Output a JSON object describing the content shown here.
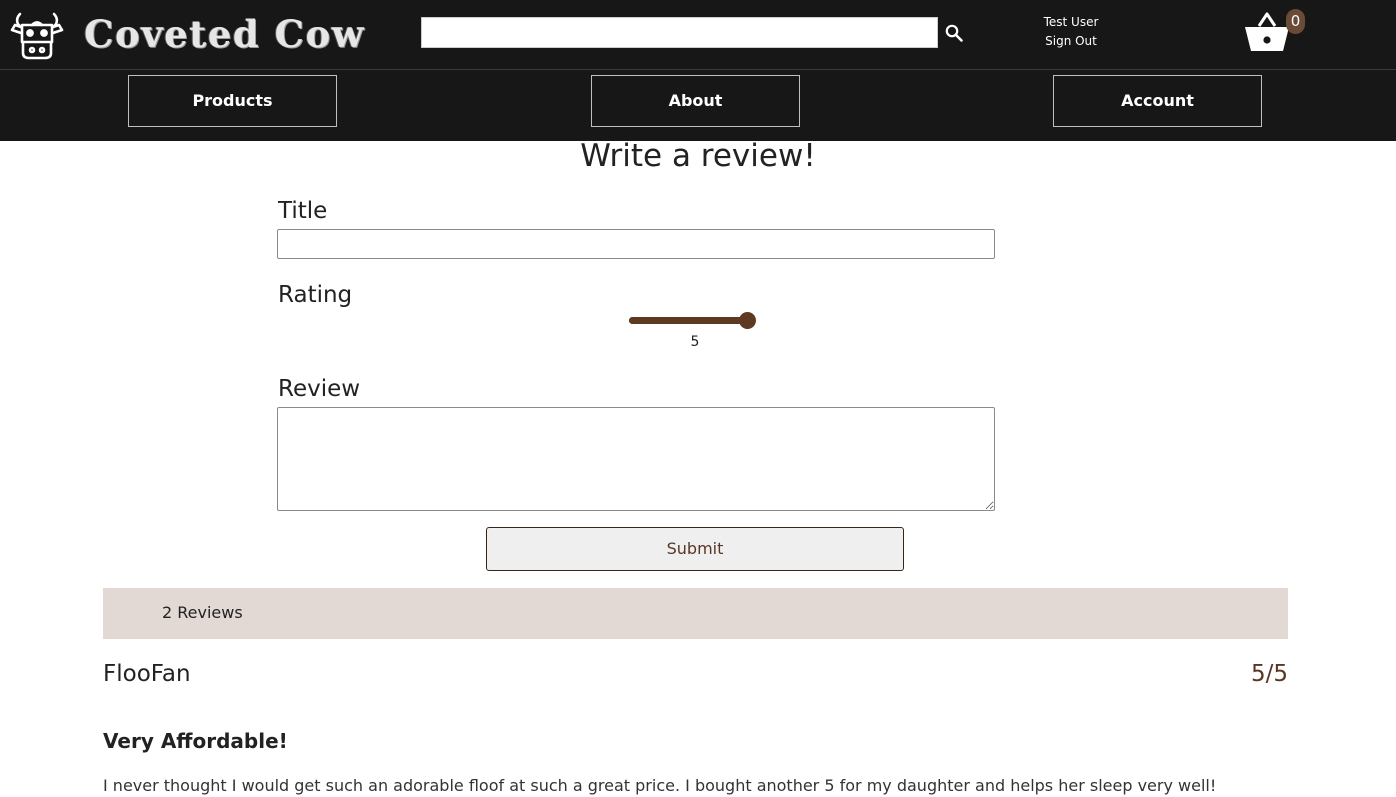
{
  "header": {
    "brand": "Coveted Cow",
    "search": {
      "value": "",
      "placeholder": ""
    },
    "user": {
      "name": "Test User",
      "signout_label": "Sign Out"
    },
    "cart": {
      "count": "0"
    }
  },
  "nav": {
    "items": [
      {
        "label": "Products"
      },
      {
        "label": "About"
      },
      {
        "label": "Account"
      }
    ]
  },
  "review_form": {
    "heading": "Write a review!",
    "title_label": "Title",
    "title_value": "",
    "rating_label": "Rating",
    "rating": {
      "value": "5",
      "min": 1,
      "max": 5
    },
    "review_label": "Review",
    "review_value": "",
    "submit_label": "Submit"
  },
  "reviews": {
    "count_label": "2 Reviews",
    "items": [
      {
        "author": "FlooFan",
        "score": "5/5",
        "title": "Very Affordable!",
        "body": "I never thought I would get such an adorable floof at such a great price. I bought another 5 for my daughter and helps her sleep very well!"
      }
    ]
  },
  "colors": {
    "header_bg": "#171717",
    "accent_brown": "#5e3a22",
    "reviews_bar": "#e2d9d4"
  },
  "icons": {
    "logo": "cow-head-icon",
    "search": "search-icon",
    "cart": "basket-icon"
  }
}
